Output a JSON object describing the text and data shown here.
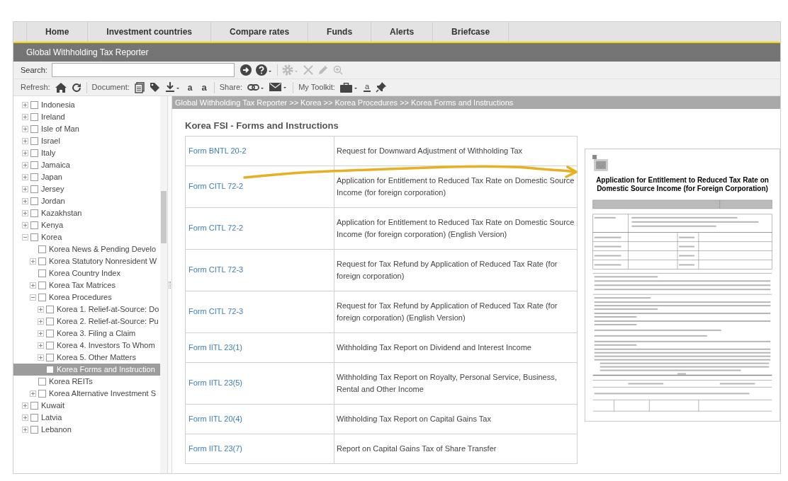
{
  "nav": {
    "tabs": [
      {
        "label": "Home"
      },
      {
        "label": "Investment countries"
      },
      {
        "label": "Compare rates"
      },
      {
        "label": "Funds"
      },
      {
        "label": "Alerts"
      },
      {
        "label": "Briefcase"
      }
    ]
  },
  "title_bar": {
    "title": "Global Withholding Tax Reporter"
  },
  "search": {
    "label": "Search:"
  },
  "toolbar": {
    "refresh_label": "Refresh:",
    "document_label": "Document:",
    "font_smaller": "a",
    "font_larger": "a",
    "share_label": "Share:",
    "toolkit_label": "My Toolkit:",
    "highlight_glyph": "a"
  },
  "tree": {
    "items": [
      {
        "label": "Indonesia",
        "kind": "folder",
        "expanded": false,
        "checked": false,
        "selected": false
      },
      {
        "label": "Ireland",
        "kind": "folder",
        "expanded": false,
        "checked": false,
        "selected": false
      },
      {
        "label": "Isle of Man",
        "kind": "folder",
        "expanded": false,
        "checked": false,
        "selected": false
      },
      {
        "label": "Israel",
        "kind": "folder",
        "expanded": false,
        "checked": false,
        "selected": false
      },
      {
        "label": "Italy",
        "kind": "folder",
        "expanded": false,
        "checked": false,
        "selected": false
      },
      {
        "label": "Jamaica",
        "kind": "folder",
        "expanded": false,
        "checked": false,
        "selected": false
      },
      {
        "label": "Japan",
        "kind": "folder",
        "expanded": false,
        "checked": false,
        "selected": false
      },
      {
        "label": "Jersey",
        "kind": "folder",
        "expanded": false,
        "checked": false,
        "selected": false
      },
      {
        "label": "Jordan",
        "kind": "folder",
        "expanded": false,
        "checked": false,
        "selected": false
      },
      {
        "label": "Kazakhstan",
        "kind": "folder",
        "expanded": false,
        "checked": false,
        "selected": false
      },
      {
        "label": "Kenya",
        "kind": "folder",
        "expanded": false,
        "checked": false,
        "selected": false
      },
      {
        "label": "Korea",
        "kind": "folder",
        "expanded": true,
        "checked": false,
        "selected": false,
        "children": [
          {
            "label": "Korea News & Pending Develo",
            "kind": "leaf",
            "checked": false,
            "selected": false
          },
          {
            "label": "Korea Statutory Nonresident W",
            "kind": "folder",
            "expanded": false,
            "checked": false,
            "selected": false
          },
          {
            "label": "Korea Country Index",
            "kind": "leaf",
            "checked": false,
            "selected": false
          },
          {
            "label": "Korea Tax Matrices",
            "kind": "folder",
            "expanded": false,
            "checked": false,
            "selected": false
          },
          {
            "label": "Korea Procedures",
            "kind": "folder",
            "expanded": true,
            "checked": false,
            "selected": false,
            "children": [
              {
                "label": "Korea 1. Relief-at-Source: Do",
                "kind": "folder",
                "expanded": false,
                "checked": false,
                "selected": false
              },
              {
                "label": "Korea 2. Relief-at-Source: Pu",
                "kind": "folder",
                "expanded": false,
                "checked": false,
                "selected": false
              },
              {
                "label": "Korea 3. Filing a Claim",
                "kind": "folder",
                "expanded": false,
                "checked": false,
                "selected": false
              },
              {
                "label": "Korea 4. Investors To Whom",
                "kind": "folder",
                "expanded": false,
                "checked": false,
                "selected": false
              },
              {
                "label": "Korea 5. Other Matters",
                "kind": "folder",
                "expanded": false,
                "checked": false,
                "selected": false
              },
              {
                "label": "Korea Forms and Instruction",
                "kind": "leaf",
                "checked": false,
                "selected": true
              }
            ]
          },
          {
            "label": "Korea REITs",
            "kind": "leaf",
            "checked": false,
            "selected": false
          },
          {
            "label": "Korea Alternative Investment S",
            "kind": "folder",
            "expanded": false,
            "checked": false,
            "selected": false
          }
        ]
      },
      {
        "label": "Kuwait",
        "kind": "folder",
        "expanded": false,
        "checked": false,
        "selected": false
      },
      {
        "label": "Latvia",
        "kind": "folder",
        "expanded": false,
        "checked": false,
        "selected": false
      },
      {
        "label": "Lebanon",
        "kind": "folder",
        "expanded": false,
        "checked": false,
        "selected": false
      }
    ]
  },
  "breadcrumb": "Global Withholding Tax Reporter >> Korea >> Korea Procedures >> Korea Forms and Instructions",
  "heading": "Korea FSI - Forms and Instructions",
  "table": {
    "rows": [
      {
        "form": "Form BNTL 20-2",
        "description": "Request for Downward Adjustment of Withholding Tax"
      },
      {
        "form": "Form CITL 72-2",
        "description": "Application for Entitlement to Reduced Tax Rate on Domestic Source Income (for foreign corporation)"
      },
      {
        "form": "Form CITL 72-2",
        "description": "Application for Entitlement to Reduced Tax Rate on Domestic Source Income (for foreign corporation) (English Version)"
      },
      {
        "form": "Form CITL 72-3",
        "description": "Request for Tax Refund by Application of Reduced Tax Rate (for foreign corporation)"
      },
      {
        "form": "Form CITL 72-3",
        "description": "Request for Tax Refund by Application of Reduced Tax Rate (for foreign corporation) (English Version)"
      },
      {
        "form": "Form IITL 23(1)",
        "description": "Withholding Tax Report on Dividend and Interest Income"
      },
      {
        "form": "Form IITL 23(5)",
        "description": "Withholding Tax Report on Royalty, Personal Service, Business, Rental and Other Income"
      },
      {
        "form": "Form IITL 20(4)",
        "description": "Withholding Tax Report on Capital Gains Tax"
      },
      {
        "form": "Form IITL 23(7)",
        "description": "Report on Capital Gains Tax of Share Transfer"
      }
    ]
  },
  "form_preview": {
    "title": "Application for Entitlement to Reduced Tax Rate on Domestic Source Income (for Foreign Corporation)"
  }
}
